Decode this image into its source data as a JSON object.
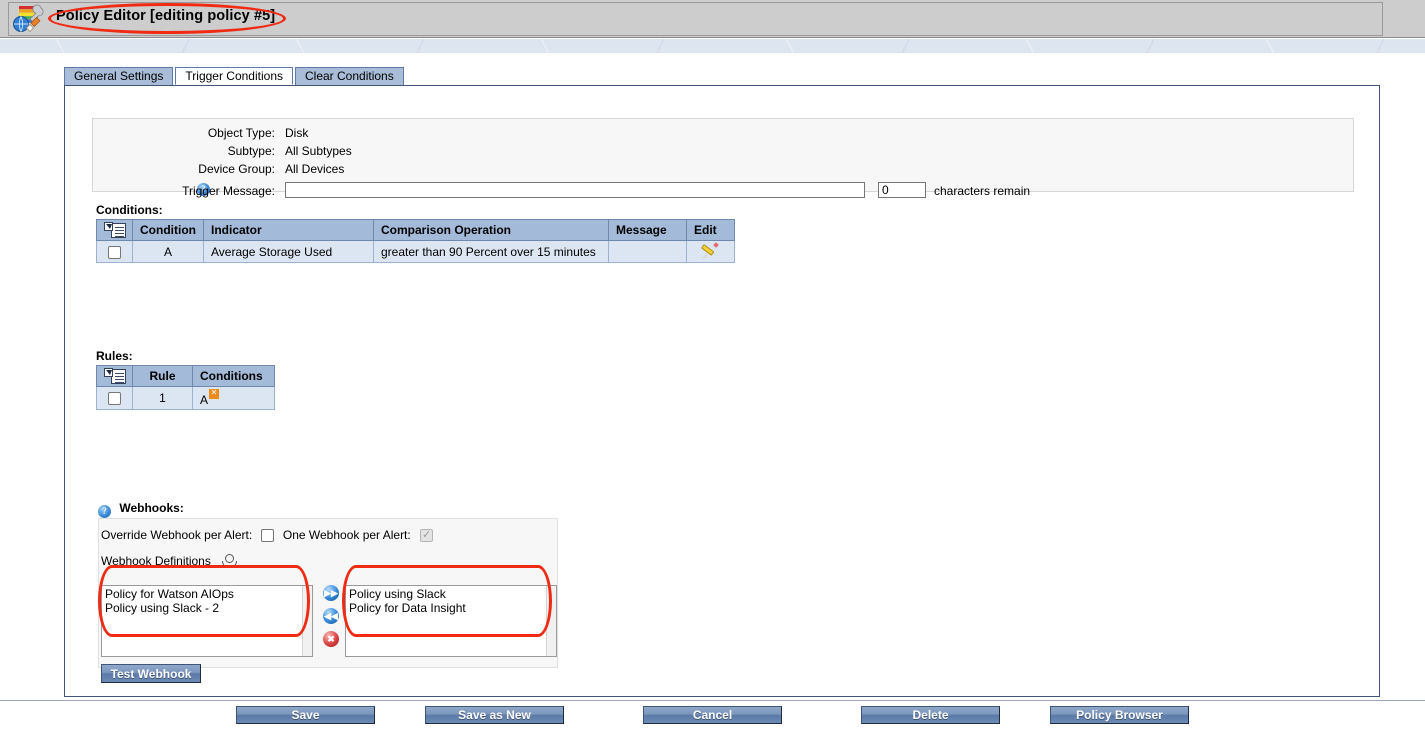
{
  "window": {
    "title": "Policy Editor [editing policy #5]",
    "app_icon": "policy-editor-icon"
  },
  "tabs": [
    {
      "label": "General Settings",
      "active": false
    },
    {
      "label": "Trigger Conditions",
      "active": true
    },
    {
      "label": "Clear Conditions",
      "active": false
    }
  ],
  "summary": {
    "rows": [
      {
        "label": "Object Type:",
        "value": "Disk"
      },
      {
        "label": "Subtype:",
        "value": "All Subtypes"
      },
      {
        "label": "Device Group:",
        "value": "All Devices"
      }
    ],
    "trigger_message": {
      "help": "?",
      "label": "Trigger Message:",
      "value": "",
      "placeholder": "",
      "chars_value": "0",
      "chars_label": "characters remain"
    }
  },
  "conditions": {
    "heading": "Conditions:",
    "columns": [
      "",
      "Condition",
      "Indicator",
      "Comparison Operation",
      "Message",
      "Edit"
    ],
    "rows": [
      {
        "selected": false,
        "condition": "A",
        "indicator": "Average Storage Used",
        "comparison": "greater than 90 Percent over 15 minutes",
        "message": "",
        "edit_icon": "pencil-icon"
      }
    ]
  },
  "rules": {
    "heading": "Rules:",
    "columns": [
      "",
      "Rule",
      "Conditions"
    ],
    "rows": [
      {
        "selected": false,
        "rule": "1",
        "conditions": "A",
        "delete_badge": "delete-condition-icon"
      }
    ]
  },
  "webhooks": {
    "heading": "Webhooks:",
    "help": "?",
    "override_label": "Override Webhook per Alert:",
    "override_checked": false,
    "one_per_alert_label": "One Webhook per Alert:",
    "one_per_alert_checked": true,
    "definitions_label": "Webhook Definitions",
    "definitions_icon": "share-icon",
    "available": [
      "Policy for Watson AIOps",
      "Policy using Slack - 2"
    ],
    "assigned": [
      "Policy using Slack",
      "Policy for Data Insight"
    ],
    "transfer": [
      {
        "name": "add-webhook-button",
        "glyph": "▶▶",
        "color": "#3a8ede"
      },
      {
        "name": "remove-webhook-button",
        "glyph": "◀◀",
        "color": "#3a8ede"
      },
      {
        "name": "delete-webhook-button",
        "glyph": "✖",
        "color": "#e04a4a"
      }
    ],
    "test_button": "Test Webhook"
  },
  "footer_buttons": [
    {
      "label": "Save",
      "name": "save-button"
    },
    {
      "label": "Save as New",
      "name": "save-as-new-button"
    },
    {
      "label": "Cancel",
      "name": "cancel-button"
    },
    {
      "label": "Delete",
      "name": "delete-button"
    },
    {
      "label": "Policy Browser",
      "name": "policy-browser-button"
    }
  ],
  "colors": {
    "titlebar": "#cdcdcd",
    "tab_active": "#ffffff",
    "tab_inactive": "#a9bcd8",
    "grid_header": "#a3bad8",
    "grid_row": "#dce6f2",
    "annotation": "#ef2b14",
    "button": "#6c8ab5"
  }
}
